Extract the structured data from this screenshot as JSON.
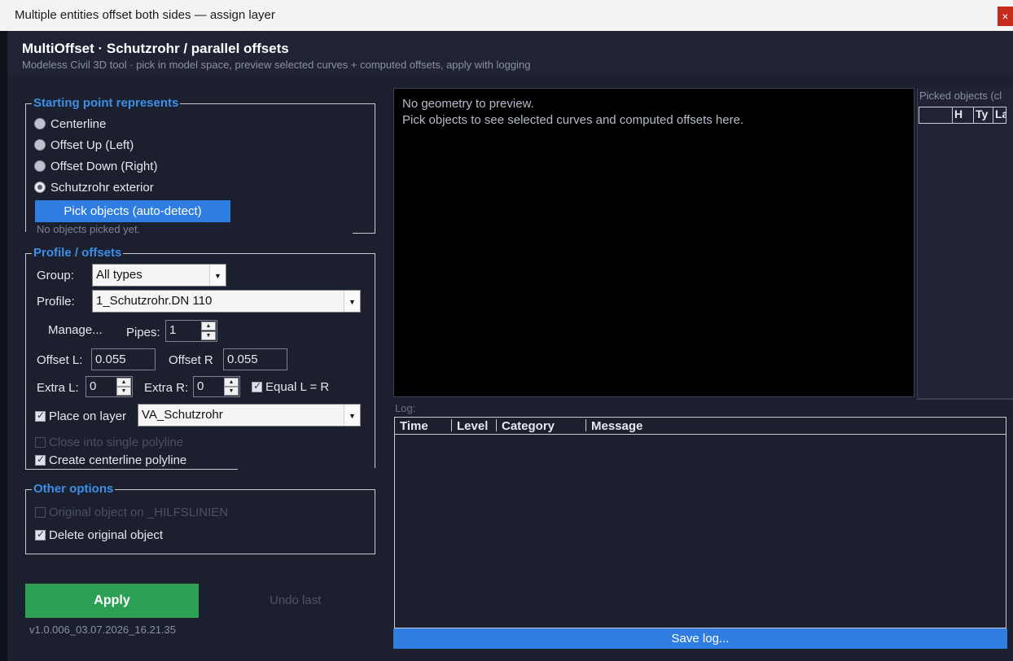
{
  "window": {
    "title": "Multiple entities offset both sides — assign layer",
    "close_glyph": "×"
  },
  "header": {
    "title": "MultiOffset · Schutzrohr / parallel offsets",
    "subtitle": "Modeless Civil 3D tool · pick in model space, preview selected curves + computed offsets, apply with logging"
  },
  "starting_point": {
    "legend": "Starting point represents",
    "options": [
      {
        "label": "Centerline",
        "selected": false
      },
      {
        "label": "Offset Up (Left)",
        "selected": false
      },
      {
        "label": "Offset Down (Right)",
        "selected": false
      },
      {
        "label": "Schutzrohr exterior",
        "selected": true
      }
    ],
    "pick_button": "Pick objects (auto-detect)",
    "status": "No objects picked yet."
  },
  "profile": {
    "legend": "Profile / offsets",
    "group_label": "Group:",
    "group_value": "All types",
    "profile_label": "Profile:",
    "profile_value": "1_Schutzrohr.DN 110",
    "manage_button": "Manage...",
    "pipes_label": "Pipes:",
    "pipes_value": "1",
    "offset_l_label": "Offset L:",
    "offset_l_value": "0.055",
    "offset_r_label": "Offset R",
    "offset_r_value": "0.055",
    "extra_l_label": "Extra L:",
    "extra_l_value": "0",
    "extra_r_label": "Extra R:",
    "extra_r_value": "0",
    "equal_label": "Equal L = R",
    "place_on_layer_label": "Place on layer",
    "layer_value": "VA_Schutzrohr",
    "close_polyline_label": "Close into single polyline",
    "create_centerline_label": "Create centerline polyline"
  },
  "other_options": {
    "legend": "Other options",
    "original_on_hilfslinien_label": "Original object on _HILFSLINIEN",
    "delete_original_label": "Delete original object"
  },
  "actions": {
    "apply": "Apply",
    "undo": "Undo last",
    "version": "v1.0.006_03.07.2026_16.21.35"
  },
  "preview": {
    "line1": "No geometry to preview.",
    "line2": "Pick objects to see selected curves and computed offsets here."
  },
  "picked": {
    "title": "Picked  objects (cl",
    "columns": [
      "H",
      "Ty",
      "La"
    ]
  },
  "log": {
    "label": "Log:",
    "columns": [
      "Time",
      "Level",
      "Category",
      "Message"
    ],
    "save_button": "Save log..."
  }
}
